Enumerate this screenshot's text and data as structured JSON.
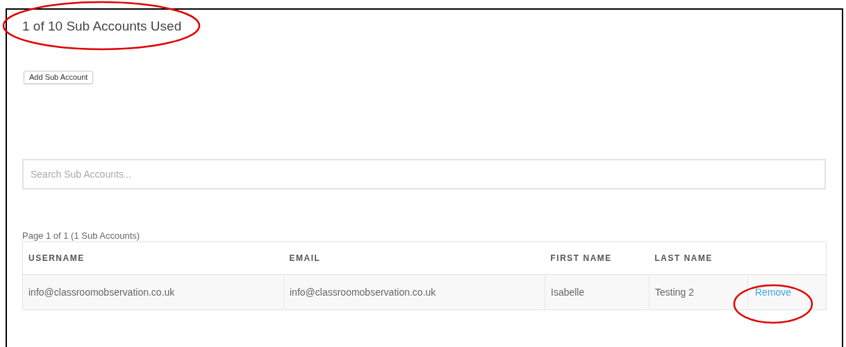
{
  "heading": "1 of 10 Sub Accounts Used",
  "add_button": "Add Sub Account",
  "search": {
    "placeholder": "Search Sub Accounts..."
  },
  "pagination": "Page 1 of 1 (1 Sub Accounts)",
  "table": {
    "columns": [
      "USERNAME",
      "EMAIL",
      "FIRST NAME",
      "LAST NAME"
    ],
    "rows": [
      {
        "cells": [
          "info@classroomobservation.co.uk",
          "info@classroomobservation.co.uk",
          "Isabelle",
          "Testing 2"
        ],
        "action": "Remove"
      }
    ]
  }
}
